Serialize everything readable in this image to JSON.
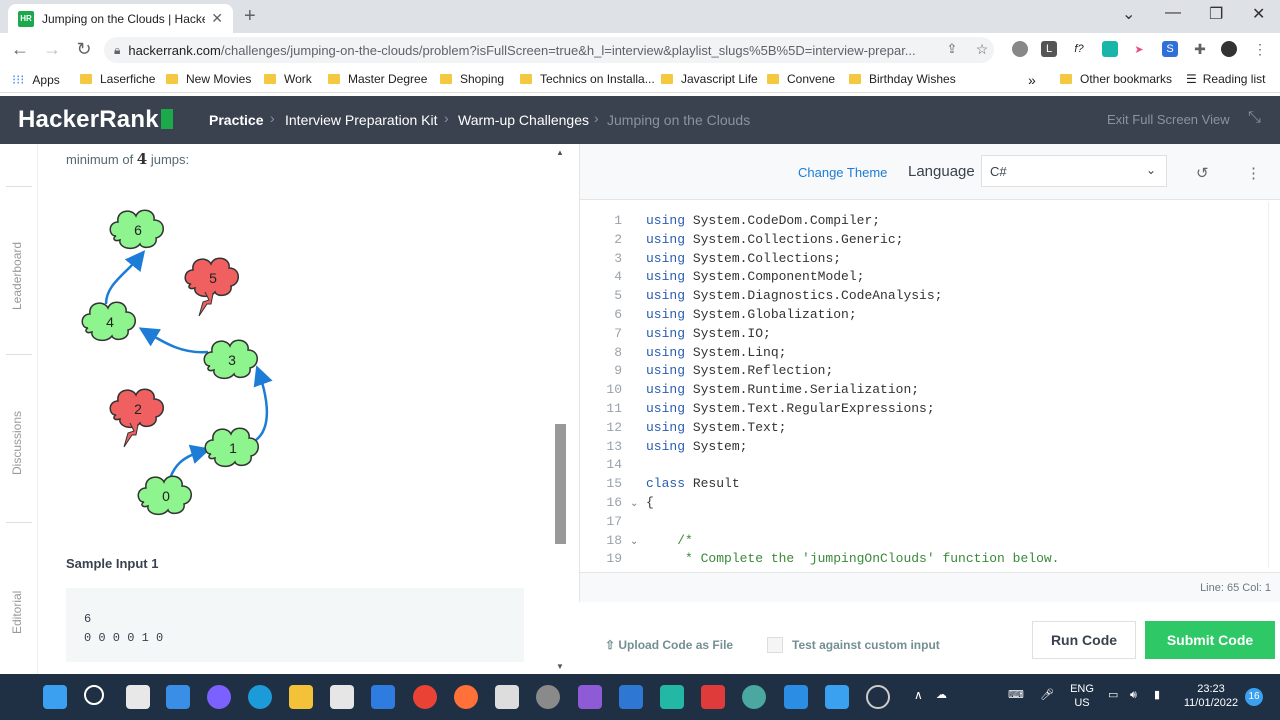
{
  "browser": {
    "tab_title": "Jumping on the Clouds | HackerR",
    "tab_favicon": "HR",
    "url_host": "hackerrank.com",
    "url_path": "/challenges/jumping-on-the-clouds/problem?isFullScreen=true&h_l=interview&playlist_slugs%5B%5D=interview-prepar...",
    "bookmarks": [
      "Apps",
      "Laserfiche",
      "New Movies",
      "Work",
      "Master Degree",
      "Shoping",
      "Technics on Installa...",
      "Javascript Life",
      "Convene",
      "Birthday Wishes"
    ],
    "bookmarks_overflow": "»",
    "other_bookmarks": "Other bookmarks",
    "reading_list": "Reading list"
  },
  "header": {
    "logo": "HackerRank",
    "crumbs": [
      "Practice",
      "Interview Preparation Kit",
      "Warm-up Challenges",
      "Jumping on the Clouds"
    ],
    "exit_label": "Exit Full Screen View"
  },
  "rail": [
    "Leaderboard",
    "Discussions",
    "Editorial"
  ],
  "problem": {
    "text_prefix": "minimum of ",
    "text_num": "4",
    "text_suffix": " jumps:",
    "clouds": [
      {
        "label": "0",
        "color": "green"
      },
      {
        "label": "1",
        "color": "green"
      },
      {
        "label": "2",
        "color": "red"
      },
      {
        "label": "3",
        "color": "green"
      },
      {
        "label": "4",
        "color": "green"
      },
      {
        "label": "5",
        "color": "red"
      },
      {
        "label": "6",
        "color": "green"
      }
    ],
    "sample_heading": "Sample Input 1",
    "sample_line1": "6",
    "sample_line2": "0 0 0 0 1 0"
  },
  "editor": {
    "change_theme": "Change Theme",
    "language_label": "Language",
    "language_value": "C#",
    "code": [
      {
        "n": "1",
        "kw": "using",
        "rest": " System.CodeDom.Compiler;"
      },
      {
        "n": "2",
        "kw": "using",
        "rest": " System.Collections.Generic;"
      },
      {
        "n": "3",
        "kw": "using",
        "rest": " System.Collections;"
      },
      {
        "n": "4",
        "kw": "using",
        "rest": " System.ComponentModel;"
      },
      {
        "n": "5",
        "kw": "using",
        "rest": " System.Diagnostics.CodeAnalysis;"
      },
      {
        "n": "6",
        "kw": "using",
        "rest": " System.Globalization;"
      },
      {
        "n": "7",
        "kw": "using",
        "rest": " System.IO;"
      },
      {
        "n": "8",
        "kw": "using",
        "rest": " System.Linq;"
      },
      {
        "n": "9",
        "kw": "using",
        "rest": " System.Reflection;"
      },
      {
        "n": "10",
        "kw": "using",
        "rest": " System.Runtime.Serialization;"
      },
      {
        "n": "11",
        "kw": "using",
        "rest": " System.Text.RegularExpressions;"
      },
      {
        "n": "12",
        "kw": "using",
        "rest": " System.Text;"
      },
      {
        "n": "13",
        "kw": "using",
        "rest": " System;"
      },
      {
        "n": "14",
        "kw": "",
        "rest": ""
      },
      {
        "n": "15",
        "kw": "class",
        "rest": " Result"
      },
      {
        "n": "16",
        "kw": "",
        "rest": "{"
      },
      {
        "n": "17",
        "kw": "",
        "rest": ""
      },
      {
        "n": "18",
        "kw": "",
        "rest": "    /*",
        "comment": true
      },
      {
        "n": "19",
        "kw": "",
        "rest": "     * Complete the 'jumpingOnClouds' function below.",
        "comment": true
      }
    ],
    "status": "Line: 65 Col: 1",
    "upload": "Upload Code as File",
    "custom_input": "Test against custom input",
    "run": "Run Code",
    "submit": "Submit Code"
  },
  "taskbar": {
    "lang1": "ENG",
    "lang2": "US",
    "time": "23:23",
    "date": "11/01/2022",
    "notif": "16"
  },
  "colors": {
    "accent": "#1ba94c",
    "header": "#39424e",
    "submit": "#2ec866",
    "cloud_green": "#8ef58e",
    "cloud_red": "#f06060"
  }
}
